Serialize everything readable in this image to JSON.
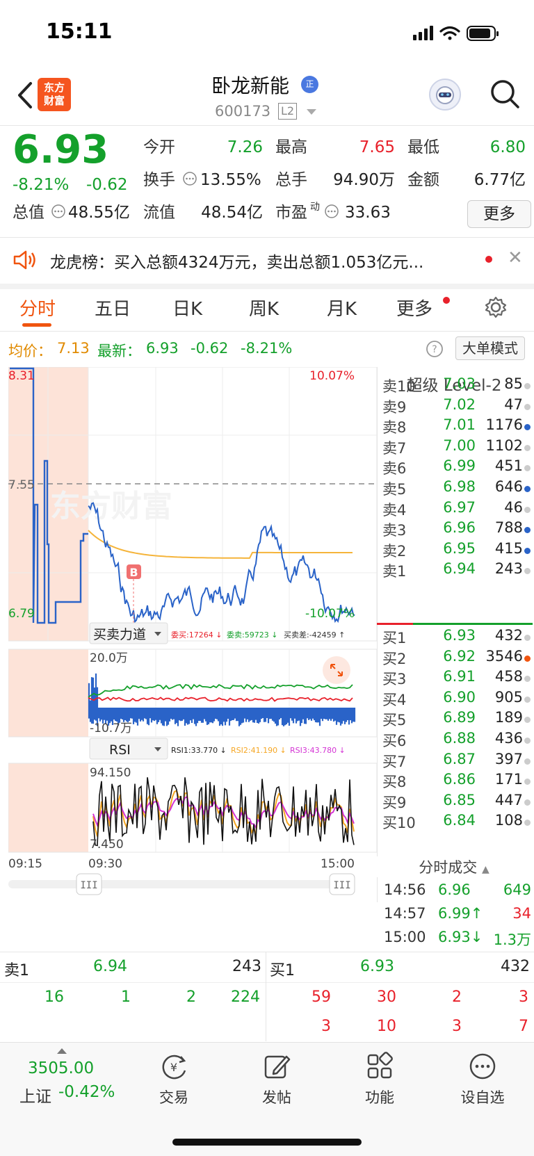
{
  "status": {
    "time": "15:11"
  },
  "header": {
    "logo_text": "东方财富",
    "title": "卧龙新能",
    "badge": "正",
    "code": "600173",
    "level": "L2"
  },
  "quote": {
    "price": "6.93",
    "change_pct": "-8.21%",
    "change": "-0.62",
    "open_label": "今开",
    "open": "7.26",
    "high_label": "最高",
    "high": "7.65",
    "low_label": "最低",
    "low": "6.80",
    "turnover_label": "换手",
    "turnover": "13.55%",
    "volume_label": "总手",
    "volume": "94.90万",
    "amount_label": "金额",
    "amount": "6.77亿",
    "mktcap_label": "总值",
    "mktcap": "48.55亿",
    "float_label": "流值",
    "float": "48.54亿",
    "pe_label": "市盈",
    "pe_sup": "动",
    "pe": "33.63",
    "more": "更多"
  },
  "notice": {
    "text": "龙虎榜：买入总额4324万元，卖出总额1.053亿元..."
  },
  "tabs": [
    "分时",
    "五日",
    "日K",
    "周K",
    "月K",
    "更多"
  ],
  "chart_header": {
    "avg_label": "均价：",
    "avg": "7.13",
    "latest_label": "最新：",
    "latest": "6.93",
    "chg": "-0.62",
    "chg_pct": "-8.21%",
    "mode": "大单模式"
  },
  "chart_labels": {
    "top_left": "8.31",
    "mid_left": "7.55",
    "bottom_left": "6.79",
    "top_right": "10.07%",
    "bottom_right": "-10.07%",
    "ind1_name": "买卖力道",
    "ind1_buy": "委买:17264 ↓",
    "ind1_sell": "委卖:59723 ↓",
    "ind1_diff": "买卖差:-42459 ↑",
    "ind1_top": "20.0万",
    "ind1_bottom": "-10.7万",
    "ind2_name": "RSI",
    "rsi1": "RSI1:33.770 ↓",
    "rsi2": "RSI2:41.190 ↓",
    "rsi3": "RSI3:43.780 ↓",
    "ind2_top": "94.150",
    "ind2_bottom": "7.450",
    "t_start": "09:15",
    "t_open": "09:30",
    "t_end": "15:00",
    "watermark": "东方财富",
    "marker": "B"
  },
  "orderbook": {
    "title": "超级 Level-2",
    "asks": [
      {
        "n": "卖10",
        "p": "7.03",
        "v": "85",
        "d": "#cccccc"
      },
      {
        "n": "卖9",
        "p": "7.02",
        "v": "47",
        "d": "#cccccc"
      },
      {
        "n": "卖8",
        "p": "7.01",
        "v": "1176",
        "d": "#2a63c8"
      },
      {
        "n": "卖7",
        "p": "7.00",
        "v": "1102",
        "d": "#cccccc"
      },
      {
        "n": "卖6",
        "p": "6.99",
        "v": "451",
        "d": "#cccccc"
      },
      {
        "n": "卖5",
        "p": "6.98",
        "v": "646",
        "d": "#2a63c8"
      },
      {
        "n": "卖4",
        "p": "6.97",
        "v": "46",
        "d": "#cccccc"
      },
      {
        "n": "卖3",
        "p": "6.96",
        "v": "788",
        "d": "#2a63c8"
      },
      {
        "n": "卖2",
        "p": "6.95",
        "v": "415",
        "d": "#2a63c8"
      },
      {
        "n": "卖1",
        "p": "6.94",
        "v": "243",
        "d": "#cccccc"
      }
    ],
    "bids": [
      {
        "n": "买1",
        "p": "6.93",
        "v": "432",
        "d": "#cccccc"
      },
      {
        "n": "买2",
        "p": "6.92",
        "v": "3546",
        "d": "#f0540f"
      },
      {
        "n": "买3",
        "p": "6.91",
        "v": "458",
        "d": "#cccccc"
      },
      {
        "n": "买4",
        "p": "6.90",
        "v": "905",
        "d": "#cccccc"
      },
      {
        "n": "买5",
        "p": "6.89",
        "v": "189",
        "d": "#cccccc"
      },
      {
        "n": "买6",
        "p": "6.88",
        "v": "436",
        "d": "#cccccc"
      },
      {
        "n": "买7",
        "p": "6.87",
        "v": "397",
        "d": "#cccccc"
      },
      {
        "n": "买8",
        "p": "6.86",
        "v": "171",
        "d": "#cccccc"
      },
      {
        "n": "买9",
        "p": "6.85",
        "v": "447",
        "d": "#cccccc"
      },
      {
        "n": "买10",
        "p": "6.84",
        "v": "108",
        "d": "#cccccc"
      }
    ]
  },
  "trades": {
    "title": "分时成交",
    "rows": [
      {
        "t": "14:56",
        "p": "6.96",
        "v": "649"
      },
      {
        "t": "14:57",
        "p": "6.99↑",
        "v": "34"
      },
      {
        "t": "15:00",
        "p": "6.93↓",
        "v": "1.3万"
      }
    ]
  },
  "queue": {
    "sell_label": "卖1",
    "sell_price": "6.94",
    "sell_vol": "243",
    "buy_label": "买1",
    "buy_price": "6.93",
    "buy_vol": "432",
    "sell_orders": [
      "16",
      "1",
      "2",
      "224"
    ],
    "buy_orders_row1": [
      "59",
      "30",
      "2",
      "3"
    ],
    "buy_orders_row2": [
      "3",
      "10",
      "3",
      "7"
    ]
  },
  "bottom_nav": {
    "index_value": "3505.00",
    "index_name": "上证",
    "index_chg": "-0.42%",
    "trade": "交易",
    "post": "发帖",
    "func": "功能",
    "watch": "设自选"
  }
}
